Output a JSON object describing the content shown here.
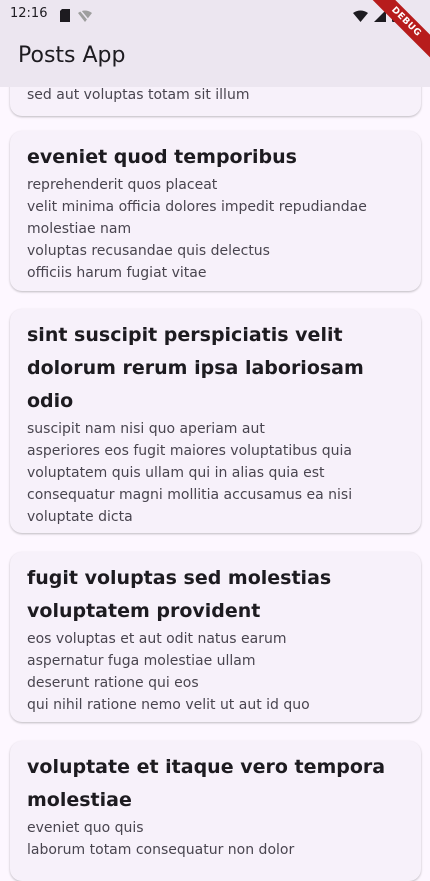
{
  "status_bar": {
    "time": "12:16",
    "left_icons": [
      "sim-card-icon",
      "wifi-off-icon"
    ],
    "right_icons": [
      "wifi-icon",
      "signal-icon",
      "battery-icon"
    ]
  },
  "app_bar": {
    "title": "Posts App",
    "debug_label": "DEBUG"
  },
  "posts": [
    {
      "title": "",
      "body": "sed aut voluptas totam sit illum"
    },
    {
      "title": "eveniet quod temporibus",
      "body": "reprehenderit quos placeat\nvelit minima officia dolores impedit repudiandae molestiae nam\nvoluptas recusandae quis delectus\nofficiis harum fugiat vitae"
    },
    {
      "title": "sint suscipit perspiciatis velit dolorum rerum ipsa laboriosam odio",
      "body": "suscipit nam nisi quo aperiam aut\nasperiores eos fugit maiores voluptatibus quia\nvoluptatem quis ullam qui in alias quia est\nconsequatur magni mollitia accusamus ea nisi voluptate dicta"
    },
    {
      "title": "fugit voluptas sed molestias voluptatem provident",
      "body": "eos voluptas et aut odit natus earum\naspernatur fuga molestiae ullam\ndeserunt ratione qui eos\nqui nihil ratione nemo velit ut aut id quo"
    },
    {
      "title": "voluptate et itaque vero tempora molestiae",
      "body": "eveniet quo quis\nlaborum totam consequatur non dolor"
    }
  ],
  "colors": {
    "app_bar": "#ece6f0",
    "background": "#fdf7ff",
    "card": "#f7f1fa",
    "debug_banner": "#b71c1c"
  }
}
